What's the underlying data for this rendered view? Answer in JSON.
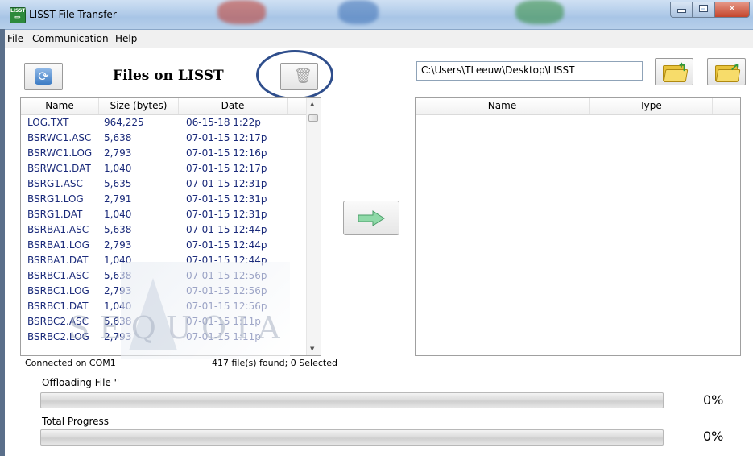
{
  "window": {
    "title": "LISST File Transfer",
    "icon_text": "LISST",
    "icon": "app-transfer-icon"
  },
  "menu": [
    "File",
    "Communication",
    "Help"
  ],
  "left_panel": {
    "heading": "Files on LISST",
    "refresh_icon": "refresh-icon",
    "delete_icon": "trash-icon",
    "columns": [
      "Name",
      "Size (bytes)",
      "Date"
    ],
    "rows": [
      [
        "LOG.TXT",
        "964,225",
        "06-15-18 1:22p"
      ],
      [
        "BSRWC1.ASC",
        "5,638",
        "07-01-15 12:17p"
      ],
      [
        "BSRWC1.LOG",
        "2,793",
        "07-01-15 12:16p"
      ],
      [
        "BSRWC1.DAT",
        "1,040",
        "07-01-15 12:17p"
      ],
      [
        "BSRG1.ASC",
        "5,635",
        "07-01-15 12:31p"
      ],
      [
        "BSRG1.LOG",
        "2,791",
        "07-01-15 12:31p"
      ],
      [
        "BSRG1.DAT",
        "1,040",
        "07-01-15 12:31p"
      ],
      [
        "BSRBA1.ASC",
        "5,638",
        "07-01-15 12:44p"
      ],
      [
        "BSRBA1.LOG",
        "2,793",
        "07-01-15 12:44p"
      ],
      [
        "BSRBA1.DAT",
        "1,040",
        "07-01-15 12:44p"
      ],
      [
        "BSRBC1.ASC",
        "5,638",
        "07-01-15 12:56p"
      ],
      [
        "BSRBC1.LOG",
        "2,793",
        "07-01-15 12:56p"
      ],
      [
        "BSRBC1.DAT",
        "1,040",
        "07-01-15 12:56p"
      ],
      [
        "BSRBC2.ASC",
        "5,638",
        "07-01-15 1:11p"
      ]
    ],
    "partial_row": [
      "BSRBC2.LOG",
      "2,793",
      "07-01-15 1:11p"
    ],
    "status_connection": "Connected on COM1",
    "status_count": "417 file(s) found; 0 Selected",
    "watermark": "SEQUOIA"
  },
  "transfer_button": {
    "icon": "right-arrow-icon"
  },
  "right_panel": {
    "path": "C:\\Users\\TLeeuw\\Desktop\\LISST",
    "open_folder_icon": "folder-open-icon",
    "new_folder_icon": "folder-new-icon",
    "columns": [
      "Name",
      "Type"
    ]
  },
  "progress": {
    "offload_label": "Offloading File ''",
    "offload_percent": "0%",
    "offload_fraction": 0,
    "total_label": "Total Progress",
    "total_percent": "0%",
    "total_fraction": 0
  },
  "colors": {
    "accent": "#2f4e8c",
    "file_text": "#1a2a7a",
    "progress_fill": "#3fb04a"
  }
}
